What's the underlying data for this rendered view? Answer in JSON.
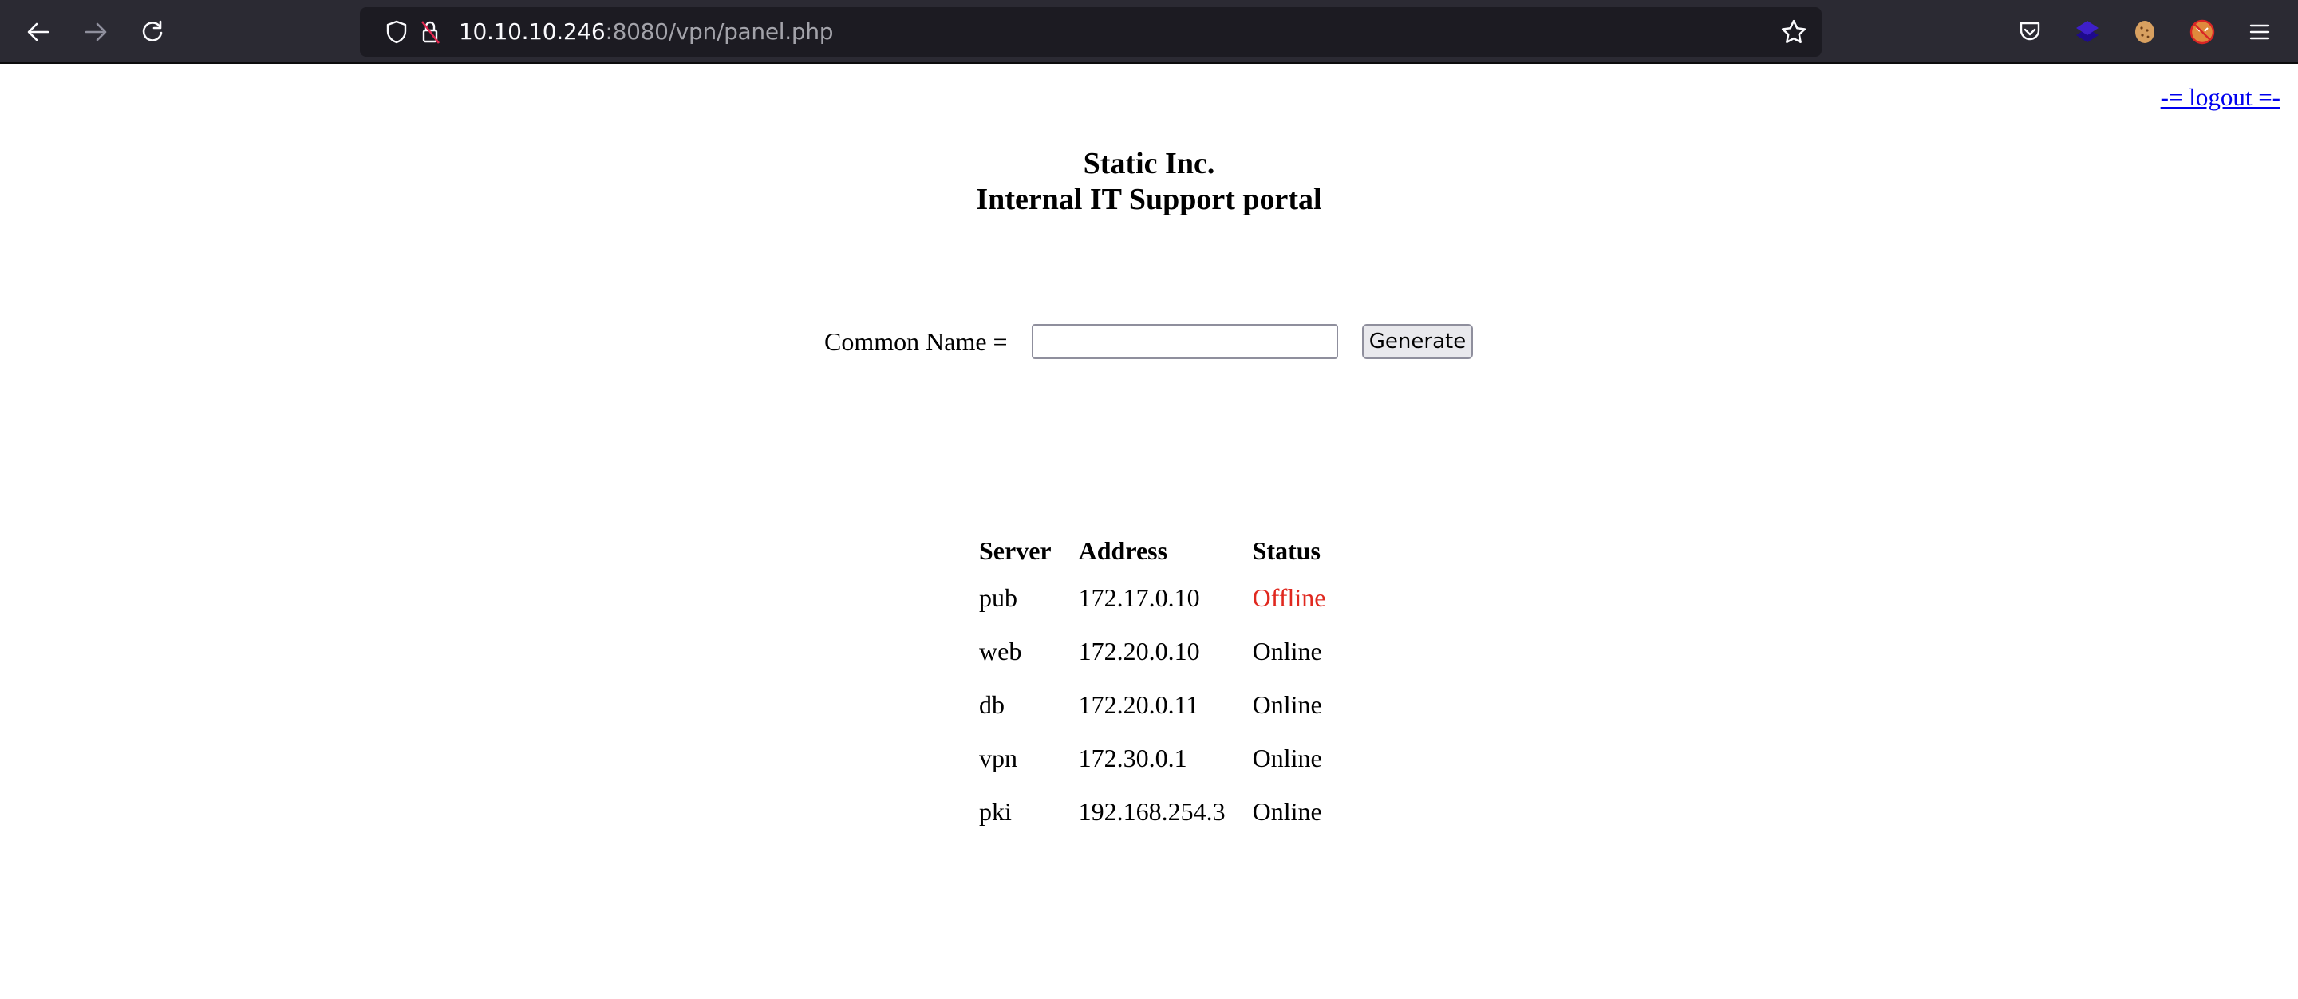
{
  "browser": {
    "url_host": "10.10.10.246",
    "url_rest": ":8080/vpn/panel.php",
    "nav": {
      "back": "arrow-left-icon",
      "forward": "arrow-right-icon",
      "reload": "reload-icon"
    },
    "extensions": [
      "pocket-icon",
      "layers-extension-icon",
      "cookie-extension-icon",
      "blocked-fox-extension-icon",
      "hamburger-menu-icon"
    ],
    "colors": {
      "toolbar": "#2b2a33",
      "urlbar": "#1c1b22"
    }
  },
  "page": {
    "logout_label": "-= logout =-",
    "title_line1": "Static Inc.",
    "title_line2": "Internal IT Support portal",
    "form": {
      "label": "Common Name =",
      "input_value": "",
      "button_label": "Generate"
    },
    "table": {
      "headers": [
        "Server",
        "Address",
        "Status"
      ],
      "rows": [
        {
          "server": "pub",
          "address": "172.17.0.10",
          "status": "Offline"
        },
        {
          "server": "web",
          "address": "172.20.0.10",
          "status": "Online"
        },
        {
          "server": "db",
          "address": "172.20.0.11",
          "status": "Online"
        },
        {
          "server": "vpn",
          "address": "172.30.0.1",
          "status": "Online"
        },
        {
          "server": "pki",
          "address": "192.168.254.3",
          "status": "Online"
        }
      ]
    },
    "colors": {
      "link": "#0000ee",
      "offline": "#e0281f",
      "online": "#000000"
    }
  }
}
